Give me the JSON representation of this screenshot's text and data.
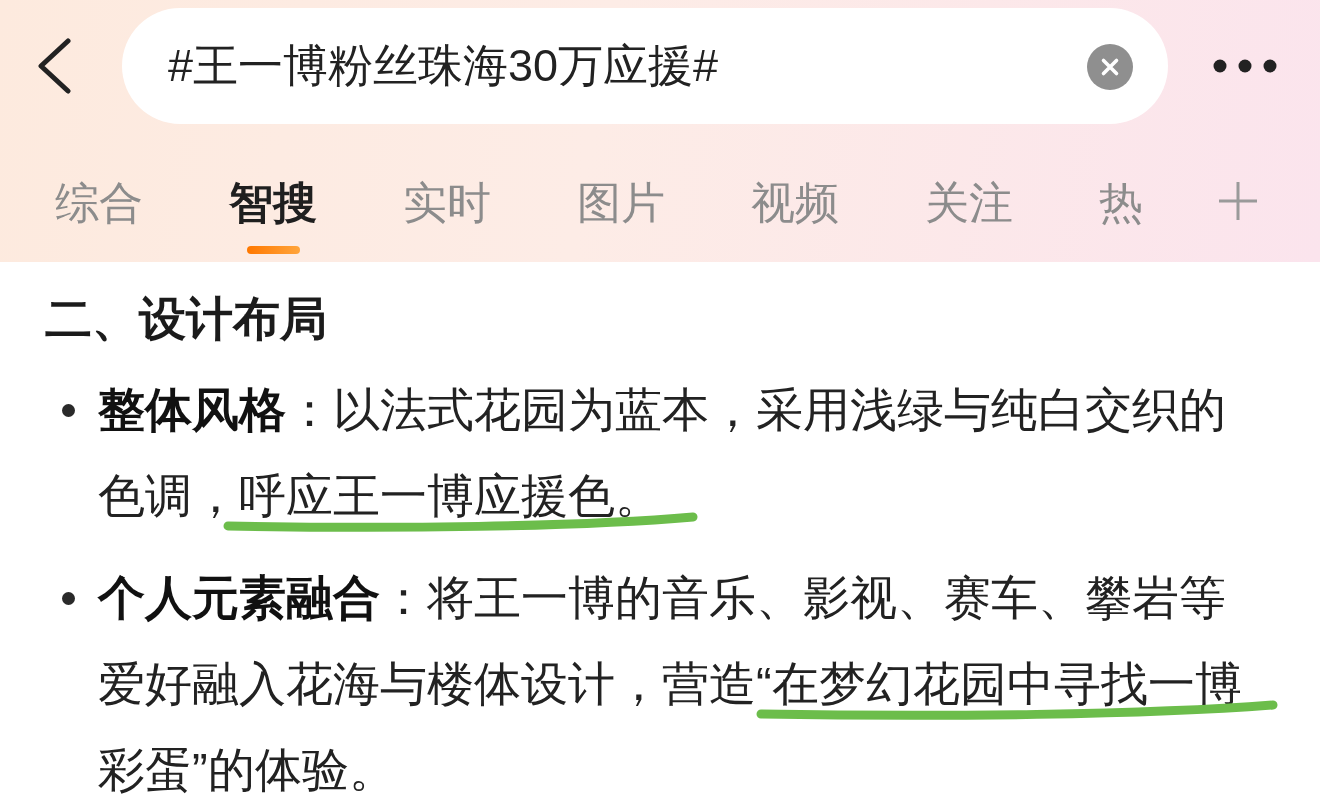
{
  "search": {
    "value": "#王一博粉丝珠海30万应援#"
  },
  "tabs": [
    {
      "label": "综合",
      "selected": false
    },
    {
      "label": "智搜",
      "selected": true
    },
    {
      "label": "实时",
      "selected": false
    },
    {
      "label": "图片",
      "selected": false
    },
    {
      "label": "视频",
      "selected": false
    },
    {
      "label": "关注",
      "selected": false
    },
    {
      "label": "热",
      "selected": false
    }
  ],
  "content": {
    "heading": "二、设计布局",
    "items": [
      {
        "segments": [
          {
            "text": "**整体风格**：以法式花园为蓝本，采用浅绿与纯白交织的色调，",
            "underlined": false
          },
          {
            "text": "呼应王一博应援色。",
            "underlined": true
          }
        ]
      },
      {
        "segments": [
          {
            "text": "**个人元素融合**：将王一博的音乐、影视、赛车、攀岩等爱好融入花海与楼体设计，营造“",
            "underlined": false
          },
          {
            "text": "在梦幻花园中寻找一博",
            "underlined": true
          },
          {
            "text": "彩蛋”的体验。",
            "underlined": false
          }
        ]
      }
    ]
  }
}
